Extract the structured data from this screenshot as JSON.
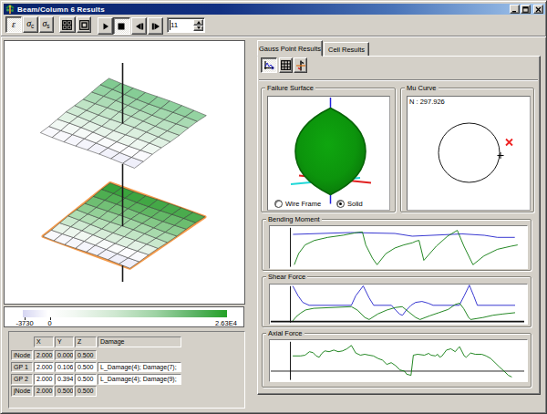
{
  "window": {
    "title": "Beam/Column 6 Results",
    "face_color": "#d4d0c8",
    "titlebar_gradient": [
      "#0a246a",
      "#a6caf0"
    ]
  },
  "toolbar": {
    "strain_label": "ε",
    "sigma_sym": "σ",
    "sigma_c_sub": "c",
    "sigma_s_sub": "s",
    "step_value": "11"
  },
  "tabs": {
    "active": "Gauss Point Results",
    "inactive": "Cell Results"
  },
  "failure_surface": {
    "title": "Failure Surface",
    "radio_wireframe": "Wire Frame",
    "radio_solid": "Solid",
    "selected": "Solid",
    "solid_color": "#0c940c",
    "solid_edge_color": "#076307",
    "axis_blue": "#2222dd",
    "axis_red": "#e02020",
    "axis_cyan": "#20d8d8",
    "geometry": {
      "cx": 68.5,
      "tip_top": 12.5,
      "tip_bottom": 107.5,
      "half_width": 38.5,
      "blue_top": [
        68.5,
        1,
        68.5,
        14.5
      ],
      "blue_bottom": [
        68.5,
        106,
        68.5,
        117.5
      ],
      "red_line": [
        34,
        86.5,
        113,
        94.5
      ],
      "cyan_line": [
        25,
        96,
        101,
        89
      ]
    }
  },
  "mu_curve": {
    "title": "Mu Curve",
    "n_label": "N : 297.926",
    "circle": {
      "cx": 67.5,
      "cy": 61.5,
      "r": 33.5
    },
    "plus_marker": {
      "x": 102,
      "y": 64.5
    },
    "x_marker": {
      "x": 111.5,
      "y": 50,
      "color": "#ee2222"
    }
  },
  "colorbar": {
    "stops": [
      "#d6d6f2 0%",
      "#e9e9f8 6%",
      "#ffffff 12.5%",
      "#f2f8f2 25%",
      "#cfe8d1 45%",
      "#9ed3a4 65%",
      "#58b262 85%",
      "#23a126 100%"
    ],
    "labels": [
      {
        "text": "-3730",
        "x": 22
      },
      {
        "text": "0",
        "x": 49.5
      },
      {
        "text": "2.63E4",
        "x": 243
      }
    ],
    "ticks": [
      21.5,
      49.5
    ]
  },
  "table": {
    "headers": [
      "",
      "X",
      "Y",
      "Z",
      "Damage"
    ],
    "rows": [
      {
        "label": "iNode",
        "x": "2.000",
        "y": "0.000",
        "z": "0.500",
        "damage": "",
        "editable": false
      },
      {
        "label": "GP 1",
        "x": "2.000",
        "y": "0.106",
        "z": "0.500",
        "damage": "L_Damage(4); Damage(7);",
        "editable": true
      },
      {
        "label": "GP 2",
        "x": "2.000",
        "y": "0.394",
        "z": "0.500",
        "damage": "L_Damage(4); Damage(9);",
        "editable": true
      },
      {
        "label": "jNode",
        "x": "2.000",
        "y": "0.500",
        "z": "0.500",
        "damage": "",
        "editable": false
      }
    ]
  },
  "scene3d": {
    "axis_color": "#1a1a1a",
    "surfaces": [
      {
        "name": "upper-shell",
        "corners": {
          "left": [
            39.3,
            100.5
          ],
          "top": [
            114.5,
            41
          ],
          "right": [
            221.3,
            81.3
          ],
          "bottom": [
            142.5,
            139
          ]
        },
        "n": 8,
        "wave": 0.55,
        "outline": null,
        "ramp": [
          [
            0,
            "#e2e2f6"
          ],
          [
            0.22,
            "#fdfdfe"
          ],
          [
            0.55,
            "#c2e5c8"
          ],
          [
            0.8,
            "#8bcf9a"
          ],
          [
            1,
            "#5fbb74"
          ]
        ]
      },
      {
        "name": "lower-shell",
        "corners": {
          "left": [
            42.2,
            214.2
          ],
          "top": [
            115.8,
            155.7
          ],
          "right": [
            219.8,
            192.5
          ],
          "bottom": [
            137.5,
            248.8
          ]
        },
        "n": 8,
        "wave": 0.45,
        "outline": "#f49b4b",
        "ramp": [
          [
            0,
            "#e2e2f6"
          ],
          [
            0.22,
            "#fdfdfe"
          ],
          [
            0.5,
            "#a5d9a9"
          ],
          [
            0.75,
            "#4fae52"
          ],
          [
            1,
            "#129015"
          ]
        ]
      }
    ],
    "axis_segments": [
      [
        129.5,
        24,
        90.5
      ],
      [
        129.5,
        135,
        203
      ],
      [
        129.5,
        246,
        264
      ]
    ]
  },
  "chart_data": [
    {
      "type": "line",
      "title": "Bending Moment",
      "x_axis_frac": 0.08,
      "baseline_frac": null,
      "series": [
        {
          "name": "moment",
          "color": "#0c7a0c",
          "points": [
            [
              0.095,
              0.08
            ],
            [
              0.112,
              0.348
            ],
            [
              0.137,
              0.552
            ],
            [
              0.173,
              0.659
            ],
            [
              0.225,
              0.733
            ],
            [
              0.286,
              0.785
            ],
            [
              0.329,
              0.837
            ],
            [
              0.347,
              0.857
            ],
            [
              0.36,
              0.86
            ],
            [
              0.373,
              0.552
            ],
            [
              0.399,
              0.237
            ],
            [
              0.417,
              0.08
            ],
            [
              0.451,
              0.343
            ],
            [
              0.486,
              0.478
            ],
            [
              0.521,
              0.552
            ],
            [
              0.555,
              0.604
            ],
            [
              0.568,
              0.641
            ],
            [
              0.58,
              0.66
            ],
            [
              0.599,
              0.185
            ],
            [
              0.647,
              0.522
            ],
            [
              0.691,
              0.761
            ],
            [
              0.729,
              0.9
            ],
            [
              0.755,
              0.522
            ],
            [
              0.79,
              0.08
            ],
            [
              0.833,
              0.291
            ],
            [
              0.885,
              0.448
            ],
            [
              0.938,
              0.522
            ],
            [
              0.964,
              0.552
            ]
          ]
        },
        {
          "name": "capacity",
          "color": "#2222cc",
          "points": [
            [
              0.09,
              0.804
            ],
            [
              0.313,
              0.848
            ],
            [
              0.486,
              0.826
            ],
            [
              0.554,
              0.761
            ],
            [
              0.748,
              0.815
            ],
            [
              0.834,
              0.783
            ],
            [
              0.885,
              0.733
            ],
            [
              0.953,
              0.733
            ]
          ]
        }
      ]
    },
    {
      "type": "line",
      "title": "Shear Force",
      "x_axis_frac": 0.08,
      "baseline_frac": 0.055,
      "series": [
        {
          "name": "shear",
          "color": "#0c7a0c",
          "points": [
            [
              0.089,
              0.073
            ],
            [
              0.103,
              0.182
            ],
            [
              0.12,
              0.273
            ],
            [
              0.139,
              0.352
            ],
            [
              0.171,
              0.393
            ],
            [
              0.317,
              0.436
            ],
            [
              0.342,
              0.341
            ],
            [
              0.369,
              0.161
            ],
            [
              0.386,
              0.107
            ],
            [
              0.42,
              0.25
            ],
            [
              0.455,
              0.348
            ],
            [
              0.489,
              0.414
            ],
            [
              0.515,
              0.436
            ],
            [
              0.541,
              0.295
            ],
            [
              0.567,
              0.161
            ],
            [
              0.584,
              0.107
            ],
            [
              0.623,
              0.205
            ],
            [
              0.658,
              0.284
            ],
            [
              0.694,
              0.364
            ],
            [
              0.721,
              0.491
            ],
            [
              0.738,
              0.523
            ],
            [
              0.754,
              0.386
            ],
            [
              0.773,
              0.161
            ],
            [
              0.781,
              0.107
            ],
            [
              0.829,
              0.159
            ],
            [
              0.868,
              0.216
            ],
            [
              0.907,
              0.25
            ],
            [
              0.954,
              0.282
            ]
          ]
        },
        {
          "name": "capacity",
          "color": "#2222cc",
          "points": [
            [
              0.089,
              0.964
            ],
            [
              0.11,
              0.711
            ],
            [
              0.128,
              0.545
            ],
            [
              0.153,
              0.47
            ],
            [
              0.317,
              0.47
            ],
            [
              0.334,
              0.711
            ],
            [
              0.363,
              0.964
            ],
            [
              0.386,
              0.659
            ],
            [
              0.404,
              0.47
            ],
            [
              0.473,
              0.47
            ],
            [
              0.489,
              0.348
            ],
            [
              0.506,
              0.239
            ],
            [
              0.516,
              0.216
            ],
            [
              0.53,
              0.341
            ],
            [
              0.549,
              0.47
            ],
            [
              0.567,
              0.545
            ],
            [
              0.592,
              0.568
            ],
            [
              0.616,
              0.523
            ],
            [
              0.635,
              0.47
            ],
            [
              0.737,
              0.47
            ],
            [
              0.756,
              0.711
            ],
            [
              0.776,
              0.984
            ],
            [
              0.793,
              0.711
            ],
            [
              0.807,
              0.47
            ],
            [
              0.954,
              0.47
            ]
          ]
        }
      ]
    },
    {
      "type": "line",
      "title": "Axial Force",
      "x_axis_frac": 0.08,
      "baseline_frac": 0.245,
      "series": [
        {
          "name": "axial",
          "color": "#0c7a0c",
          "points": [
            [
              0.089,
              0.615
            ],
            [
              0.12,
              0.615
            ],
            [
              0.137,
              0.634
            ],
            [
              0.154,
              0.717
            ],
            [
              0.168,
              0.696
            ],
            [
              0.18,
              0.615
            ],
            [
              0.192,
              0.583
            ],
            [
              0.202,
              0.677
            ],
            [
              0.214,
              0.738
            ],
            [
              0.231,
              0.717
            ],
            [
              0.249,
              0.757
            ],
            [
              0.266,
              0.717
            ],
            [
              0.283,
              0.738
            ],
            [
              0.3,
              0.789
            ],
            [
              0.317,
              0.872
            ],
            [
              0.334,
              0.687
            ],
            [
              0.352,
              0.634
            ],
            [
              0.369,
              0.655
            ],
            [
              0.386,
              0.634
            ],
            [
              0.403,
              0.615
            ],
            [
              0.421,
              0.553
            ],
            [
              0.438,
              0.513
            ],
            [
              0.455,
              0.409
            ],
            [
              0.472,
              0.451
            ],
            [
              0.489,
              0.379
            ],
            [
              0.506,
              0.274
            ],
            [
              0.524,
              0.245
            ],
            [
              0.532,
              0.172
            ],
            [
              0.549,
              0.143
            ],
            [
              0.558,
              0.634
            ],
            [
              0.575,
              0.655
            ],
            [
              0.601,
              0.634
            ],
            [
              0.618,
              0.677
            ],
            [
              0.627,
              0.634
            ],
            [
              0.644,
              0.615
            ],
            [
              0.653,
              0.655
            ],
            [
              0.661,
              0.583
            ],
            [
              0.67,
              0.615
            ],
            [
              0.687,
              0.757
            ],
            [
              0.704,
              0.789
            ],
            [
              0.721,
              0.717
            ],
            [
              0.73,
              0.789
            ],
            [
              0.738,
              0.84
            ],
            [
              0.756,
              0.615
            ],
            [
              0.764,
              0.583
            ],
            [
              0.781,
              0.687
            ],
            [
              0.799,
              0.655
            ],
            [
              0.824,
              0.655
            ],
            [
              0.841,
              0.615
            ],
            [
              0.859,
              0.553
            ],
            [
              0.876,
              0.451
            ],
            [
              0.893,
              0.347
            ],
            [
              0.911,
              0.245
            ],
            [
              0.928,
              0.143
            ],
            [
              0.941,
              0.102
            ]
          ]
        }
      ]
    }
  ]
}
